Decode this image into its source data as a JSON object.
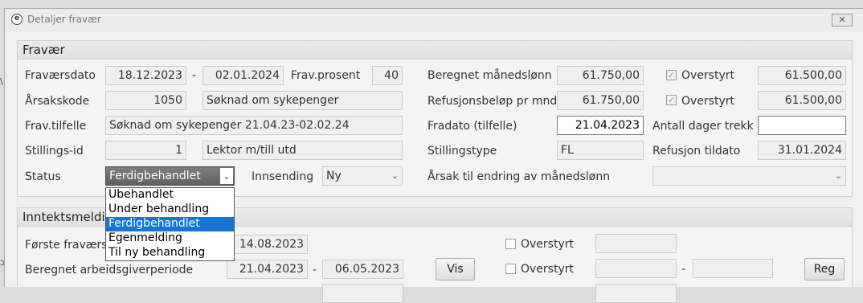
{
  "window": {
    "title": "Detaljer fravær",
    "close_label": "✕",
    "app_icon_glyph": "e"
  },
  "fravaer": {
    "heading": "Fravær",
    "fravaersdato_label": "Fraværsdato",
    "fravaersdato_from": "18.12.2023",
    "date_sep": "-",
    "fravaersdato_to": "02.01.2024",
    "frav_prosent_label": "Frav.prosent",
    "frav_prosent": "40",
    "arsakskode_label": "Årsakskode",
    "arsakskode": "1050",
    "arsakskode_text": "Søknad om sykepenger",
    "frav_tilfelle_label": "Frav.tilfelle",
    "frav_tilfelle": "Søknad om sykepenger 21.04.23-02.02.24",
    "stillings_id_label": "Stillings-id",
    "stillings_id": "1",
    "stilling_text": "Lektor m/till utd",
    "status_label": "Status",
    "status_value": "Ferdigbehandlet",
    "innsending_label": "Innsending",
    "innsending_value": "Ny",
    "beregnet_label": "Beregnet månedslønn",
    "beregnet_value": "61.750,00",
    "overstyrt_label": "Overstyrt",
    "overstyrt_value_1": "61.500,00",
    "refusjon_label": "Refusjonsbeløp pr mnd",
    "refusjon_value": "61.750,00",
    "overstyrt_value_2": "61.500,00",
    "fradato_label": "Fradato (tilfelle)",
    "fradato_value": "21.04.2023",
    "antall_dager_label": "Antall dager trekk",
    "antall_dager_value": "",
    "stillingstype_label": "Stillingstype",
    "stillingstype_value": "FL",
    "refusjon_tildato_label": "Refusjon tildato",
    "refusjon_tildato_value": "31.01.2024",
    "arsak_endring_label": "Årsak til endring av månedslønn",
    "arsak_endring_value": ""
  },
  "status_options": [
    "Ubehandlet",
    "Under behandling",
    "Ferdigbehandlet",
    "Egenmelding",
    "Til ny behandling"
  ],
  "status_selected_index": 2,
  "inntekt": {
    "heading": "Inntektsmelding",
    "forste_label": "Første fraværsdag",
    "forste_value": "14.08.2023",
    "overstyrt_label": "Overstyrt",
    "overstyrt_value_1": "",
    "beregnet_periode_label": "Beregnet arbeidsgiverperiode",
    "periode_from": "21.04.2023",
    "date_sep": "-",
    "periode_to": "06.05.2023",
    "vis_button": "Vis",
    "overstyrt_from": "",
    "overstyrt_to": "",
    "reg_button": "Reg"
  }
}
